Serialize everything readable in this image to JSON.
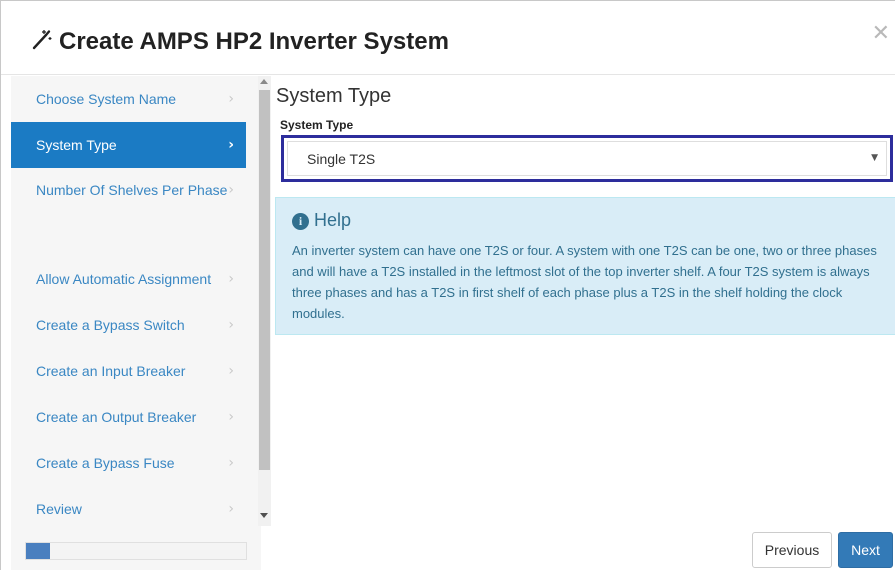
{
  "header": {
    "icon": "magic-wand-icon",
    "title": "Create AMPS HP2 Inverter System",
    "close_icon": "close-icon"
  },
  "sidebar": {
    "items": [
      {
        "label": "Choose System Name",
        "active": false
      },
      {
        "label": "System Type",
        "active": true
      },
      {
        "label": "Number Of Shelves Per Phase",
        "active": false
      },
      {
        "label": "Allow Automatic Assignment",
        "active": false
      },
      {
        "label": "Create a Bypass Switch",
        "active": false
      },
      {
        "label": "Create an Input Breaker",
        "active": false
      },
      {
        "label": "Create an Output Breaker",
        "active": false
      },
      {
        "label": "Create a Bypass Fuse",
        "active": false
      },
      {
        "label": "Review",
        "active": false
      }
    ],
    "chevron_icon": "chevron-right-icon",
    "progress_fraction": 0.11,
    "colors": {
      "active_bg": "#1b7bc4",
      "link": "#3a87c3"
    }
  },
  "main": {
    "section_title": "System Type",
    "field_label": "System Type",
    "select_value": "Single T2S",
    "help": {
      "icon": "info-circle-icon",
      "title": "Help",
      "text": "An inverter system can have one T2S or four. A system with one T2S can be one, two or three phases and will have a T2S installed in the leftmost slot of the top inverter shelf. A four T2S system is always three phases and has a T2S in first shelf of each phase plus a T2S in the shelf holding the clock modules.",
      "colors": {
        "bg": "#d9edf7",
        "text": "#31708f"
      }
    }
  },
  "footer": {
    "previous_label": "Previous",
    "next_label": "Next",
    "colors": {
      "primary": "#337ab7"
    }
  }
}
